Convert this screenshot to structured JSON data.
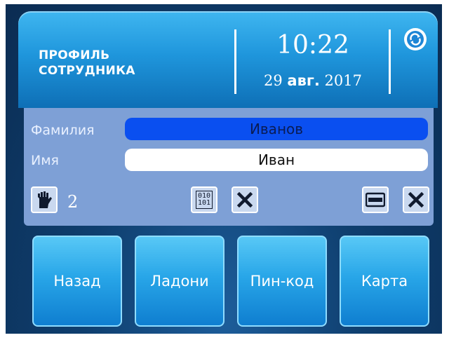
{
  "header": {
    "title_line1": "ПРОФИЛЬ",
    "title_line2": "СОТРУДНИКА",
    "time": "10:22",
    "date_day": "29",
    "date_month": "авг.",
    "date_year": "2017"
  },
  "form": {
    "surname_label": "Фамилия",
    "surname_value": "Иванов",
    "name_label": "Имя",
    "name_value": "Иван"
  },
  "credentials": {
    "palm_count": "2",
    "pin_icon_text_top": "010",
    "pin_icon_text_bottom": "101"
  },
  "buttons": {
    "back": "Назад",
    "palms": "Ладони",
    "pin": "Пин-код",
    "card": "Карта"
  },
  "colors": {
    "header": "#1f96dc",
    "panel": "#7ea0d6",
    "active_field": "#0a4ff0",
    "button": "#28a6e8"
  },
  "icons": [
    "sync-icon",
    "palm-icon",
    "pin-code-icon",
    "delete-icon",
    "card-icon"
  ]
}
